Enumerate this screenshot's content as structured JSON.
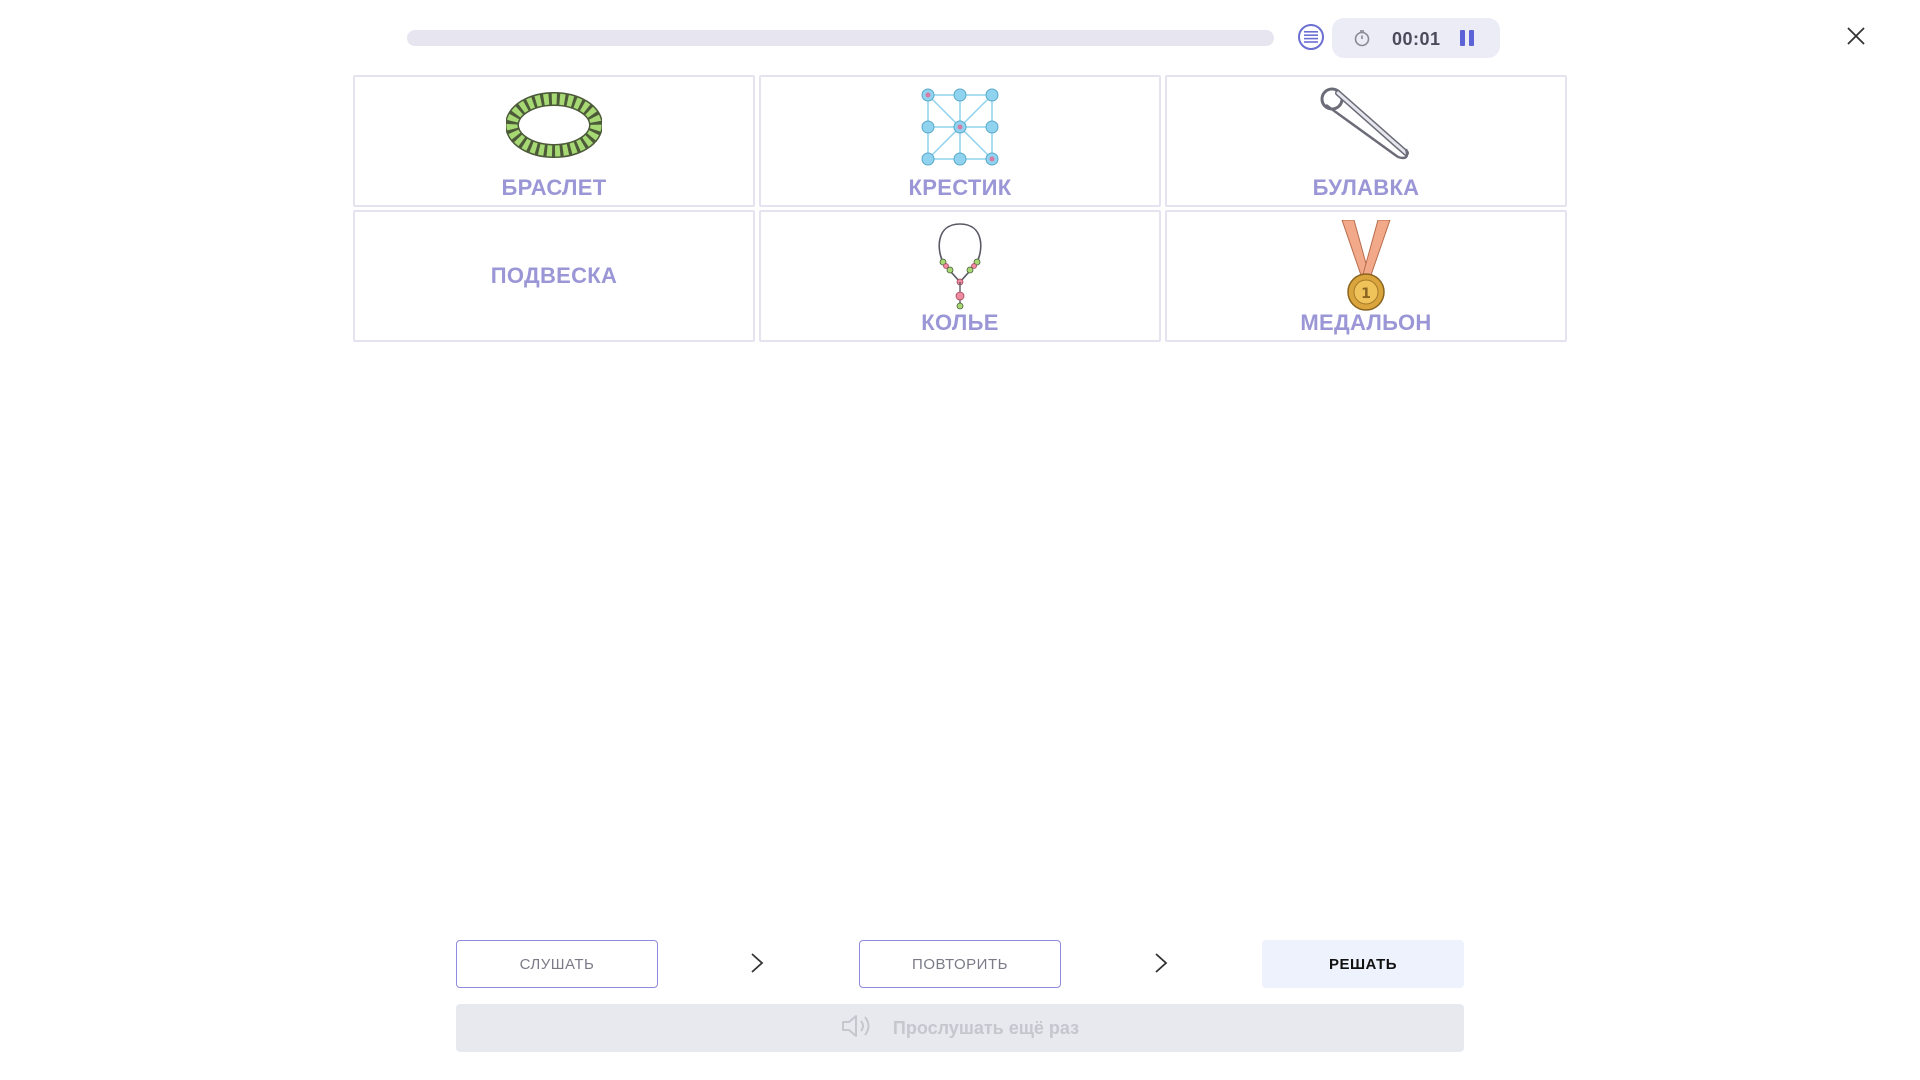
{
  "header": {
    "progress": 0,
    "timer": "00:01"
  },
  "cards": [
    {
      "label": "БРАСЛЕТ",
      "icon": "bracelet-icon"
    },
    {
      "label": "КРЕСТИК",
      "icon": "tic-tac-toe-icon"
    },
    {
      "label": "БУЛАВКА",
      "icon": "safety-pin-icon"
    },
    {
      "label": "ПОДВЕСКА",
      "icon": ""
    },
    {
      "label": "КОЛЬЕ",
      "icon": "necklace-icon"
    },
    {
      "label": "МЕДАЛЬОН",
      "icon": "medal-icon"
    }
  ],
  "steps": {
    "listen": "СЛУШАТЬ",
    "repeat": "ПОВТОРИТЬ",
    "solve": "РЕШАТЬ"
  },
  "replay": {
    "label": "Прослушать ещё раз"
  },
  "colors": {
    "accent": "#6b6fd1",
    "card_label": "#9b97d6",
    "card_border": "#e4e3ef"
  }
}
